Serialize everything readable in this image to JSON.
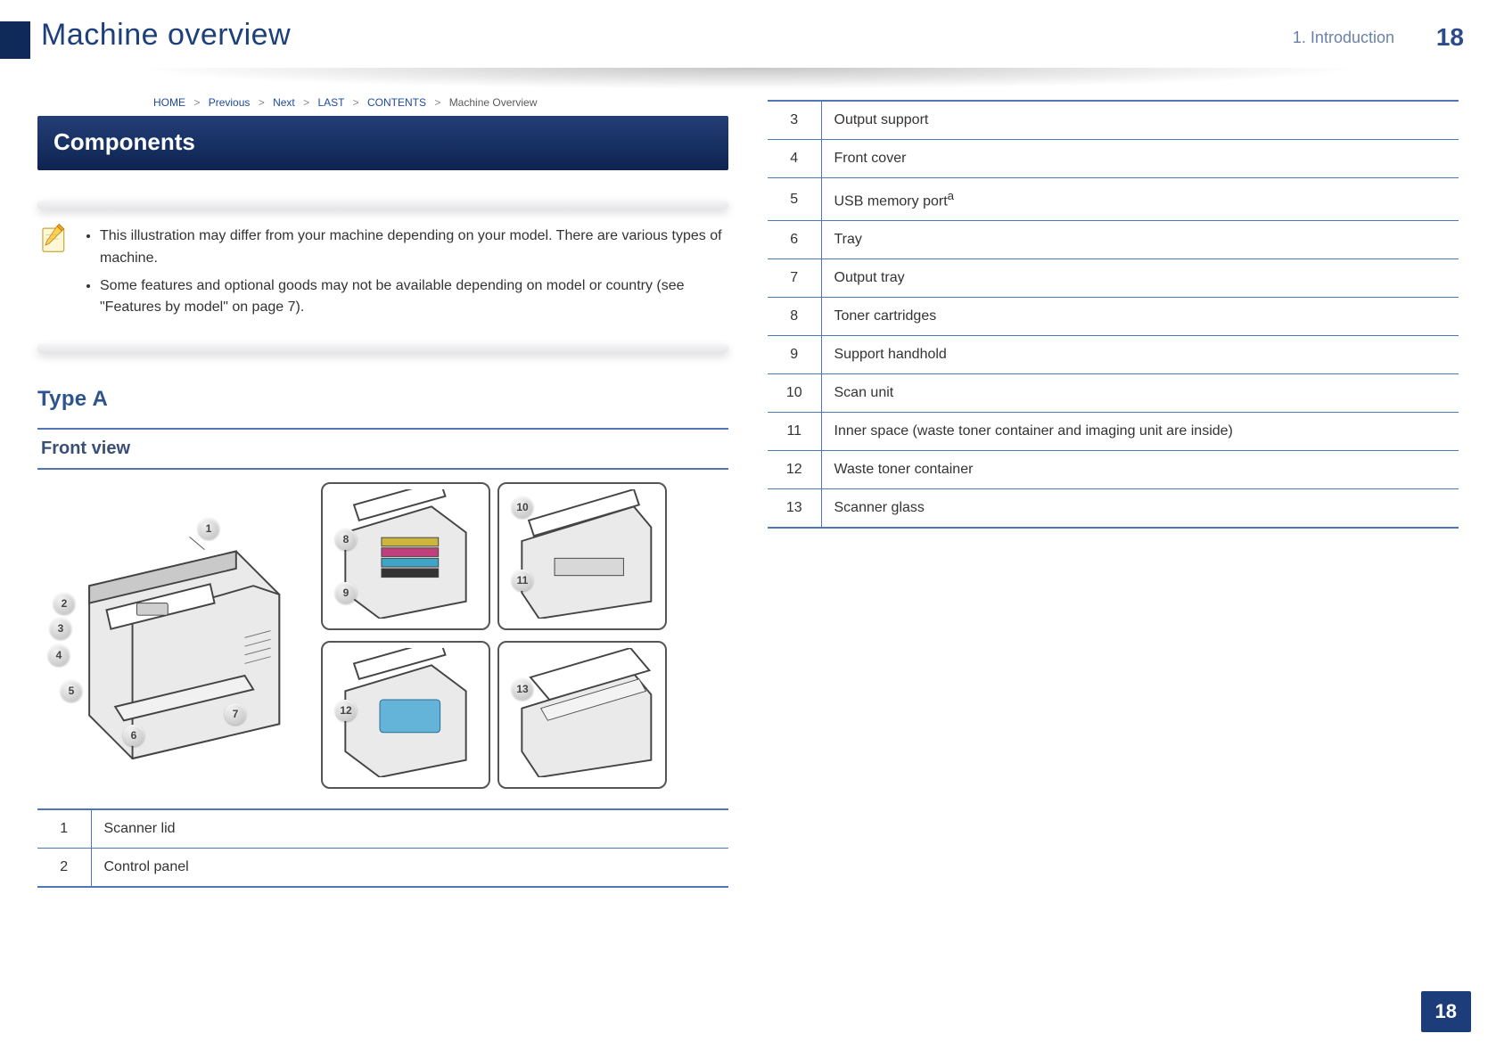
{
  "header": {
    "title": "Machine overview",
    "chapter": "1. Introduction",
    "page_decor": "18"
  },
  "crumbs": {
    "path": [
      "HOME",
      "Previous",
      "Next",
      "LAST",
      "CONTENTS"
    ],
    "separator": ">",
    "ocr_heading": "Machine Overview"
  },
  "banner": "Components",
  "note": {
    "items": [
      "This illustration may differ from your machine depending on your model. There are various types of machine.",
      "Some features and optional goods may not be available depending on model or country (see \"Features by model\" on page 7)."
    ],
    "xref_label": "\"Features by model\"",
    "xref_page": "7"
  },
  "type_heading": "Type A",
  "view_heading": "Front view",
  "callouts": {
    "main": {
      "1": "1",
      "2": "2",
      "3": "3",
      "4": "4",
      "5": "5",
      "6": "6",
      "7": "7"
    },
    "r1": {
      "8": "8",
      "9": "9"
    },
    "r2": {
      "10": "10",
      "11": "11"
    },
    "r3": {
      "12": "12"
    },
    "r4": {
      "13": "13"
    }
  },
  "left_table": {
    "rows": [
      {
        "num": "1",
        "label": "Scanner lid"
      },
      {
        "num": "2",
        "label": "Control panel"
      }
    ]
  },
  "right_table": {
    "rows": [
      {
        "num": "3",
        "label": "Output support"
      },
      {
        "num": "4",
        "label": "Front cover"
      },
      {
        "num": "5",
        "label": "USB memory port",
        "suffix": "a"
      },
      {
        "num": "6",
        "label": "Tray"
      },
      {
        "num": "7",
        "label": "Output tray"
      },
      {
        "num": "8",
        "label": "Toner cartridges"
      },
      {
        "num": "9",
        "label": "Support handhold"
      },
      {
        "num": "10",
        "label": "Scan unit"
      },
      {
        "num": "11",
        "label": "Inner space (waste toner container and imaging unit are inside)"
      },
      {
        "num": "12",
        "label": "Waste toner container"
      },
      {
        "num": "13",
        "label": "Scanner glass"
      }
    ]
  },
  "page_number": "18"
}
